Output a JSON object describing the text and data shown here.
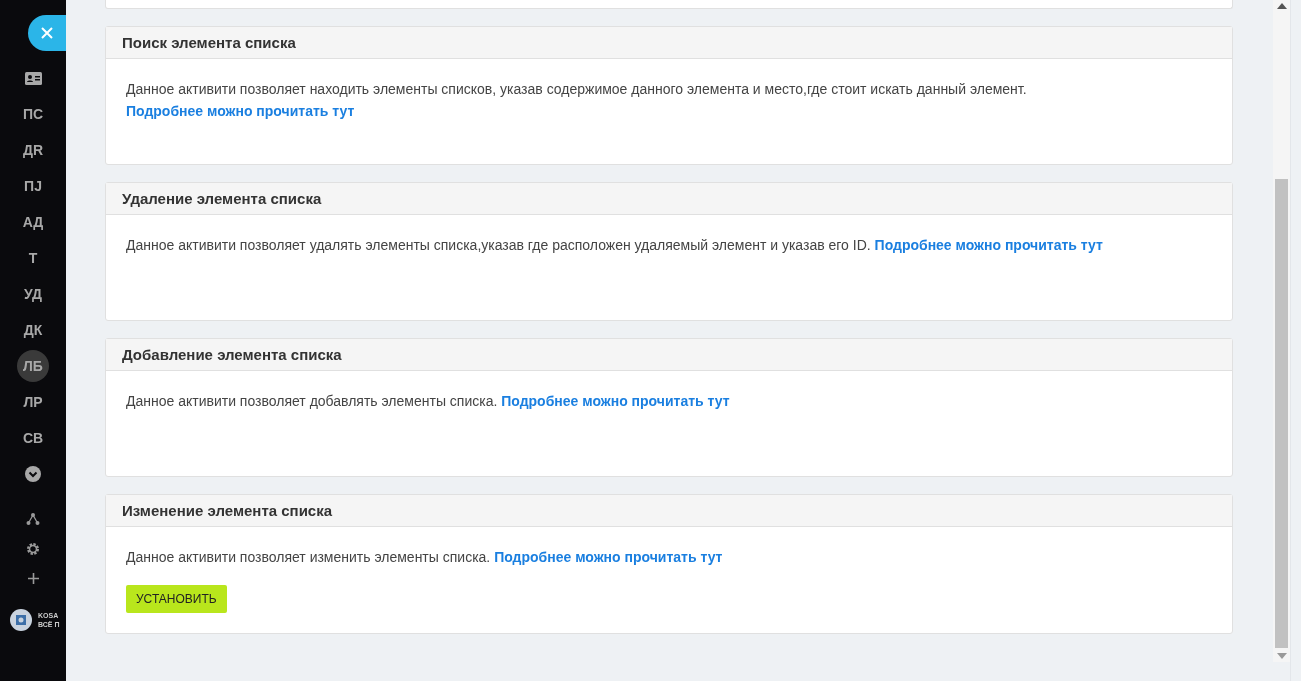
{
  "sidebar": {
    "items": [
      {
        "kind": "icon",
        "selected": false
      },
      {
        "kind": "text",
        "label": "ПС",
        "selected": false
      },
      {
        "kind": "text",
        "label": "ДR",
        "selected": false
      },
      {
        "kind": "text",
        "label": "ПJ",
        "selected": false
      },
      {
        "kind": "text",
        "label": "АД",
        "selected": false
      },
      {
        "kind": "text",
        "label": "Т",
        "selected": false
      },
      {
        "kind": "text",
        "label": "УД",
        "selected": false
      },
      {
        "kind": "text",
        "label": "ДК",
        "selected": false
      },
      {
        "kind": "text",
        "label": "ЛБ",
        "selected": true
      },
      {
        "kind": "text",
        "label": "ЛР",
        "selected": false
      },
      {
        "kind": "text",
        "label": "СВ",
        "selected": false
      },
      {
        "kind": "more",
        "selected": false
      }
    ],
    "logo": {
      "line_1": "KOSA",
      "line_2": "ВСЁ П"
    }
  },
  "cards": [
    {
      "title": "Поиск элемента списка",
      "text": "Данное активити позволяет находить элементы списков, указав содержимое данного элемента и место,где стоит искать данный элемент.",
      "link": "Подробнее можно прочитать тут"
    },
    {
      "title": "Удаление элемента списка",
      "text": "Данное активити позволяет удалять элементы списка,указав где расположен удаляемый элемент и указав его ID.",
      "link": "Подробнее можно прочитать тут"
    },
    {
      "title": "Добавление элемента списка",
      "text": "Данное активити позволяет добавлять элементы списка.",
      "link": "Подробнее можно прочитать тут"
    },
    {
      "title": "Изменение элемента списка",
      "text": "Данное активити позволяет изменить элементы списка.",
      "link": "Подробнее можно прочитать тут",
      "button": "УСТАНОВИТЬ"
    }
  ]
}
